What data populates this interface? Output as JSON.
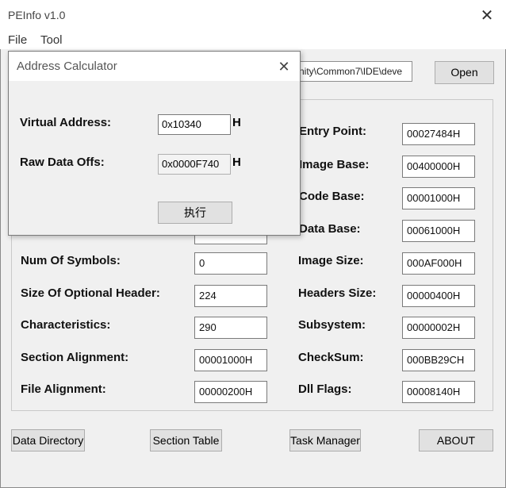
{
  "window": {
    "title": "PEInfo v1.0",
    "close_glyph": "✕"
  },
  "menu": {
    "items": [
      "File",
      "Tool"
    ]
  },
  "toolbar": {
    "path_value": "nity\\Common7\\IDE\\deve",
    "open_label": "Open"
  },
  "fields_left": [
    {
      "label": "",
      "value": ""
    },
    {
      "label": "",
      "value": ""
    },
    {
      "label": "",
      "value": ""
    },
    {
      "label": "",
      "value": ""
    },
    {
      "label": "Num Of Symbols:",
      "value": "0"
    },
    {
      "label": "Size Of Optional Header:",
      "value": "224"
    },
    {
      "label": "Characteristics:",
      "value": "290"
    },
    {
      "label": "Section Alignment:",
      "value": "00001000H"
    },
    {
      "label": "File Alignment:",
      "value": "00000200H"
    }
  ],
  "fields_right": [
    {
      "label": "Entry Point:",
      "value": "00027484H"
    },
    {
      "label": "Image Base:",
      "value": "00400000H"
    },
    {
      "label": "Code Base:",
      "value": "00001000H"
    },
    {
      "label": "Data Base:",
      "value": "00061000H"
    },
    {
      "label": "Image Size:",
      "value": "000AF000H"
    },
    {
      "label": "Headers Size:",
      "value": "00000400H"
    },
    {
      "label": "Subsystem:",
      "value": "00000002H"
    },
    {
      "label": "CheckSum:",
      "value": "000BB29CH"
    },
    {
      "label": "Dll Flags:",
      "value": "00008140H"
    }
  ],
  "bottom_buttons": [
    "Data Directory",
    "Section Table",
    "Task Manager",
    "ABOUT"
  ],
  "dialog": {
    "title": "Address Calculator",
    "close_glyph": "✕",
    "va_label": "Virtual Address:",
    "va_value": "0x10340",
    "va_suffix": "H",
    "raw_label": "Raw Data Offs:",
    "raw_value": "0x0000F740",
    "raw_suffix": "H",
    "exec_label": "执行"
  }
}
